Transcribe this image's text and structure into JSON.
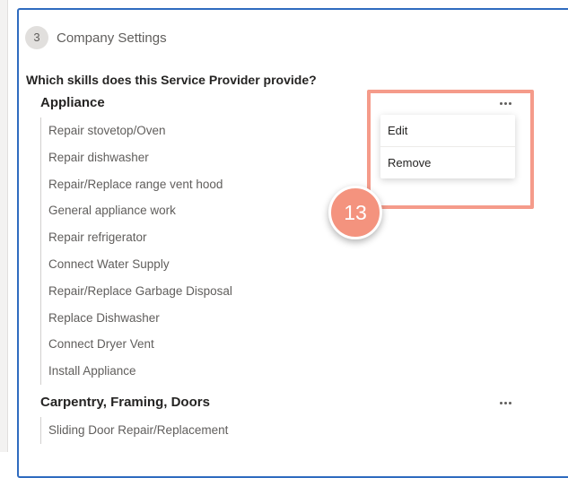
{
  "step": {
    "number": "3",
    "title": "Company Settings"
  },
  "question": "Which skills does this Service Provider provide?",
  "groups": [
    {
      "title": "Appliance",
      "skills": [
        "Repair stovetop/Oven",
        "Repair dishwasher",
        "Repair/Replace range vent hood",
        "General appliance work",
        "Repair refrigerator",
        "Connect Water Supply",
        "Repair/Replace Garbage Disposal",
        "Replace Dishwasher",
        "Connect Dryer Vent",
        "Install Appliance"
      ]
    },
    {
      "title": "Carpentry, Framing, Doors",
      "skills": [
        "Sliding Door Repair/Replacement"
      ]
    }
  ],
  "context_menu": {
    "items": [
      "Edit",
      "Remove"
    ]
  },
  "annotation": {
    "number": "13"
  },
  "colors": {
    "card_border": "#2f6bbf",
    "highlight": "#f59b8a",
    "badge": "#f4937e"
  },
  "icons": {
    "group_menu": "more-horizontal-icon"
  }
}
